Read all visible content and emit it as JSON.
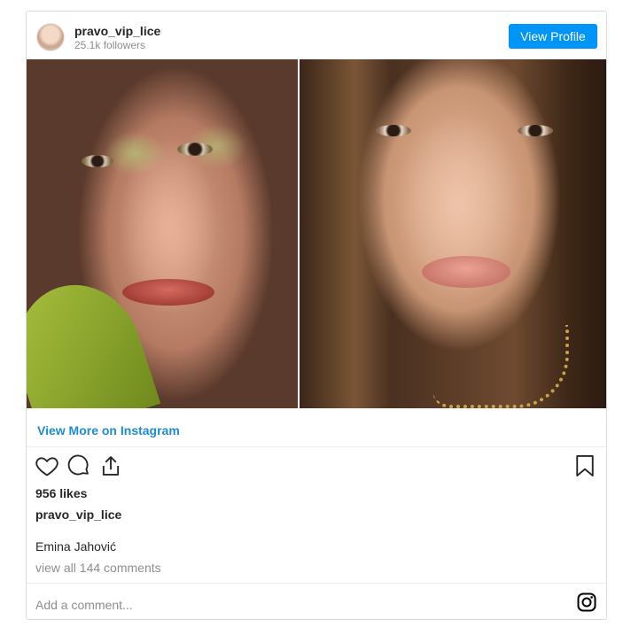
{
  "post": {
    "username": "pravo_vip_lice",
    "followers": "25.1k followers",
    "view_profile_label": "View Profile",
    "view_more_label": "View More on Instagram",
    "likes": "956 likes",
    "caption_user": "pravo_vip_lice",
    "caption_text": "Emina Jahović",
    "view_comments": "view all 144 comments",
    "comment_placeholder": "Add a comment..."
  },
  "icons": {
    "like": "heart-icon",
    "comment": "comment-icon",
    "share": "share-icon",
    "save": "bookmark-icon",
    "brand": "instagram-icon"
  },
  "colors": {
    "accent": "#0095f6",
    "link": "#1f8ccf",
    "muted": "#8e8e8e",
    "border": "#dbdbdb"
  }
}
